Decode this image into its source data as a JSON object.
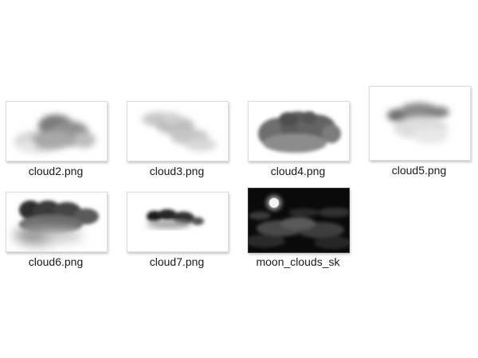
{
  "files": [
    {
      "name": "cloud2.png",
      "thumbnail": "cloud-image"
    },
    {
      "name": "cloud3.png",
      "thumbnail": "cloud-image"
    },
    {
      "name": "cloud4.png",
      "thumbnail": "cloud-image"
    },
    {
      "name": "cloud5.png",
      "thumbnail": "cloud-image"
    },
    {
      "name": "cloud6.png",
      "thumbnail": "cloud-image"
    },
    {
      "name": "cloud7.png",
      "thumbnail": "cloud-image"
    },
    {
      "name": "moon_clouds_sk",
      "thumbnail": "moon-night-sky-image"
    }
  ]
}
